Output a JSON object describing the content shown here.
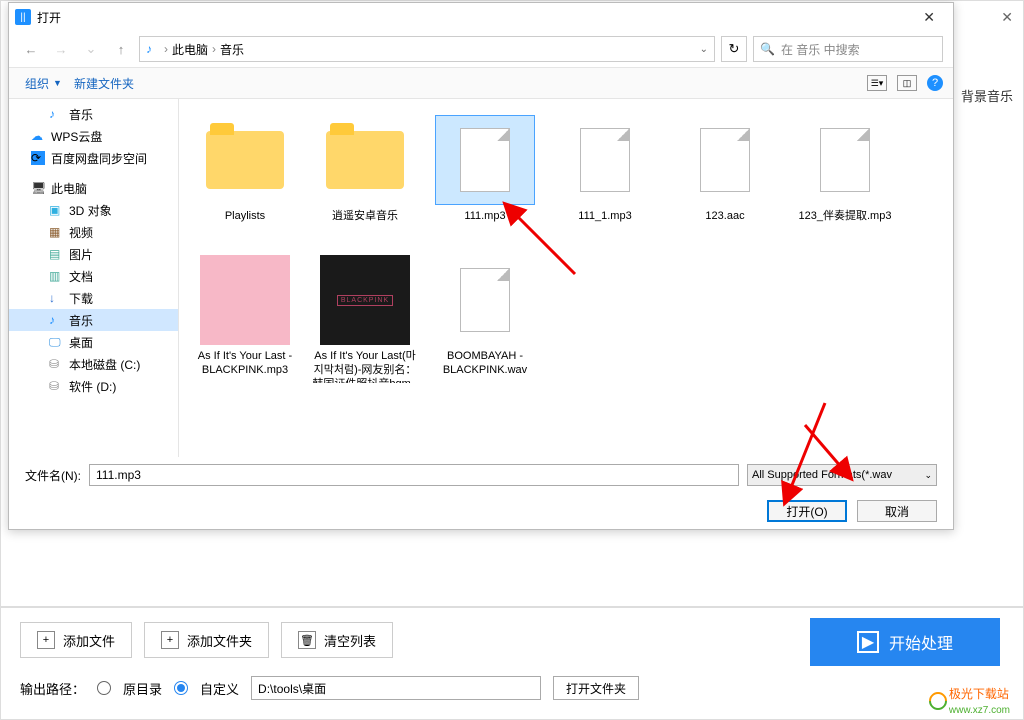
{
  "outer": {
    "label_behind": "背景音乐"
  },
  "dialog": {
    "title": "打开",
    "breadcrumb": {
      "root": "此电脑",
      "folder": "音乐"
    },
    "search_placeholder": "在 音乐 中搜索",
    "toolbar": {
      "organize": "组织",
      "new_folder": "新建文件夹"
    },
    "filename_label": "文件名(N):",
    "filename_value": "111.mp3",
    "format_filter": "All Supported Formats(*.wav",
    "open_btn": "打开(O)",
    "cancel_btn": "取消"
  },
  "sidebar": {
    "items": [
      {
        "label": "音乐",
        "icon": "note",
        "lv": 2
      },
      {
        "label": "WPS云盘",
        "icon": "cloud",
        "lv": 1
      },
      {
        "label": "百度网盘同步空间",
        "icon": "sync",
        "lv": 1
      },
      {
        "label": "此电脑",
        "icon": "pc",
        "lv": 1
      },
      {
        "label": "3D 对象",
        "icon": "cube",
        "lv": 2
      },
      {
        "label": "视频",
        "icon": "vid",
        "lv": 2
      },
      {
        "label": "图片",
        "icon": "pic",
        "lv": 2
      },
      {
        "label": "文档",
        "icon": "doc",
        "lv": 2
      },
      {
        "label": "下载",
        "icon": "dl",
        "lv": 2
      },
      {
        "label": "音乐",
        "icon": "note",
        "lv": 2,
        "active": true
      },
      {
        "label": "桌面",
        "icon": "desk",
        "lv": 2
      },
      {
        "label": "本地磁盘 (C:)",
        "icon": "disk",
        "lv": 2
      },
      {
        "label": "软件 (D:)",
        "icon": "disk",
        "lv": 2
      }
    ]
  },
  "files": [
    {
      "name": "Playlists",
      "type": "folder"
    },
    {
      "name": "逍遥安卓音乐",
      "type": "folder"
    },
    {
      "name": "111.mp3",
      "type": "file",
      "selected": true
    },
    {
      "name": "111_1.mp3",
      "type": "file"
    },
    {
      "name": "123.aac",
      "type": "file"
    },
    {
      "name": "123_伴奏提取.mp3",
      "type": "file"
    },
    {
      "name": "As If It's Your Last - BLACKPINK.mp3",
      "type": "album-pink"
    },
    {
      "name": "As If It's Your Last(마지막처럼)-网友别名：韩国证件照抖音bgm - B...",
      "type": "album-black"
    },
    {
      "name": "BOOMBAYAH - BLACKPINK.wav",
      "type": "file"
    }
  ],
  "bottom": {
    "add_file": "添加文件",
    "add_folder": "添加文件夹",
    "clear_list": "清空列表",
    "start": "开始处理",
    "output_label": "输出路径：",
    "radio_original": "原目录",
    "radio_custom": "自定义",
    "path_value": "D:\\tools\\桌面",
    "open_folder": "打开文件夹",
    "watermark_text": "极光下载站",
    "watermark_url": "www.xz7.com"
  }
}
